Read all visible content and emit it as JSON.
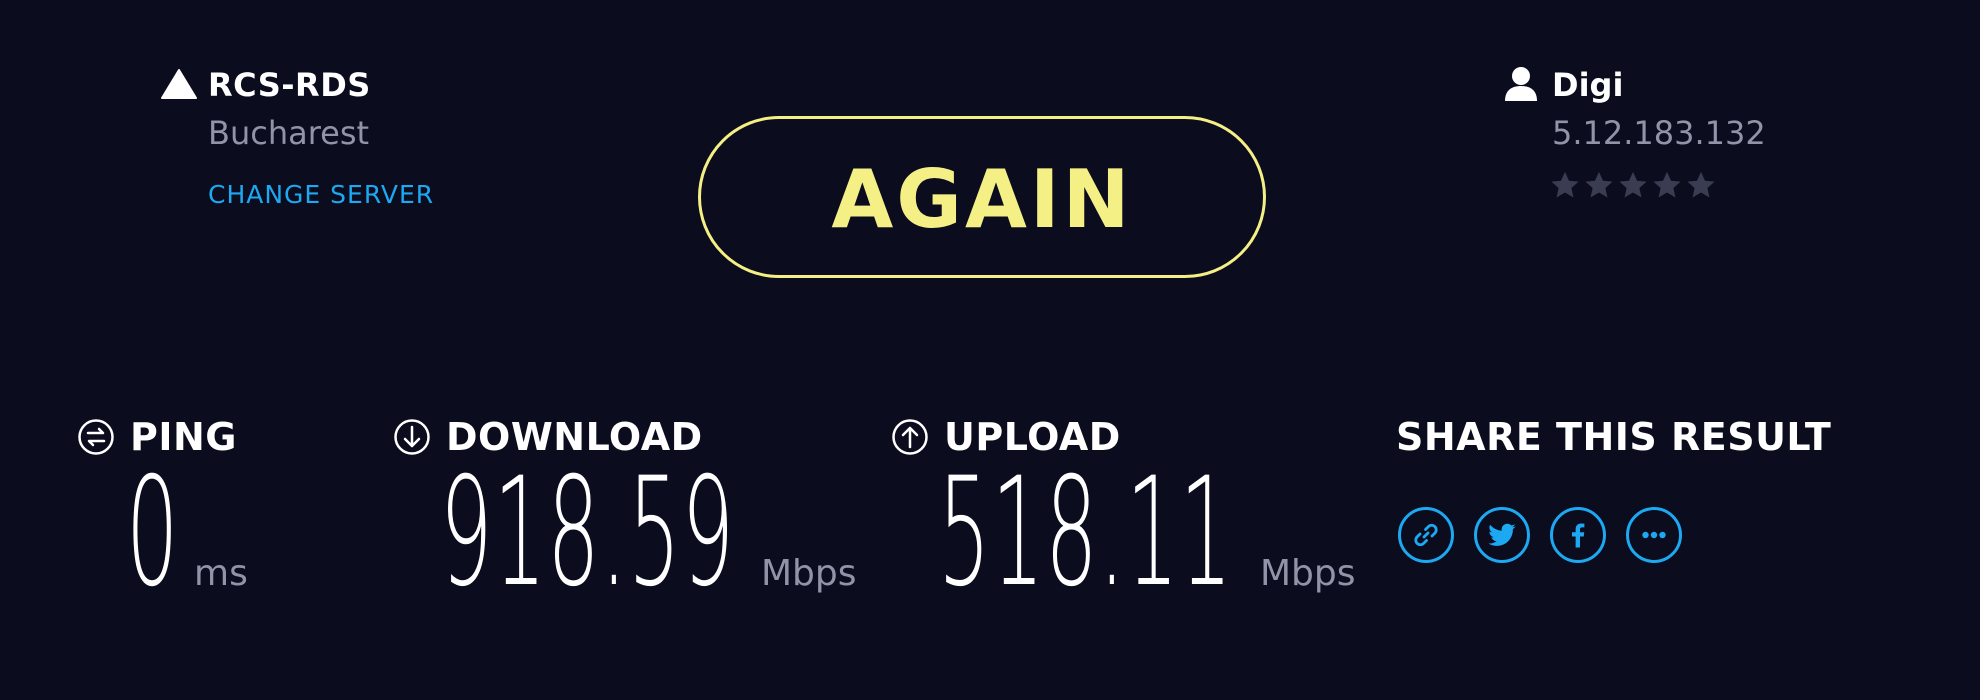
{
  "server": {
    "name": "RCS-RDS",
    "location": "Bucharest",
    "change_label": "CHANGE SERVER"
  },
  "again_button": {
    "label": "AGAIN"
  },
  "provider": {
    "name": "Digi",
    "ip": "5.12.183.132",
    "rating_stars": 5
  },
  "metrics": {
    "ping": {
      "label": "PING",
      "value": "0",
      "unit": "ms"
    },
    "download": {
      "label": "DOWNLOAD",
      "value": "918.59",
      "unit": "Mbps"
    },
    "upload": {
      "label": "UPLOAD",
      "value": "518.11",
      "unit": "Mbps"
    }
  },
  "share": {
    "title": "SHARE THIS RESULT",
    "buttons": [
      "link-icon",
      "twitter-icon",
      "facebook-icon",
      "more-icon"
    ]
  },
  "colors": {
    "background": "#0b0c1e",
    "accent_yellow": "#f4f086",
    "accent_blue": "#1da8f2",
    "muted_text": "#9193a8"
  }
}
